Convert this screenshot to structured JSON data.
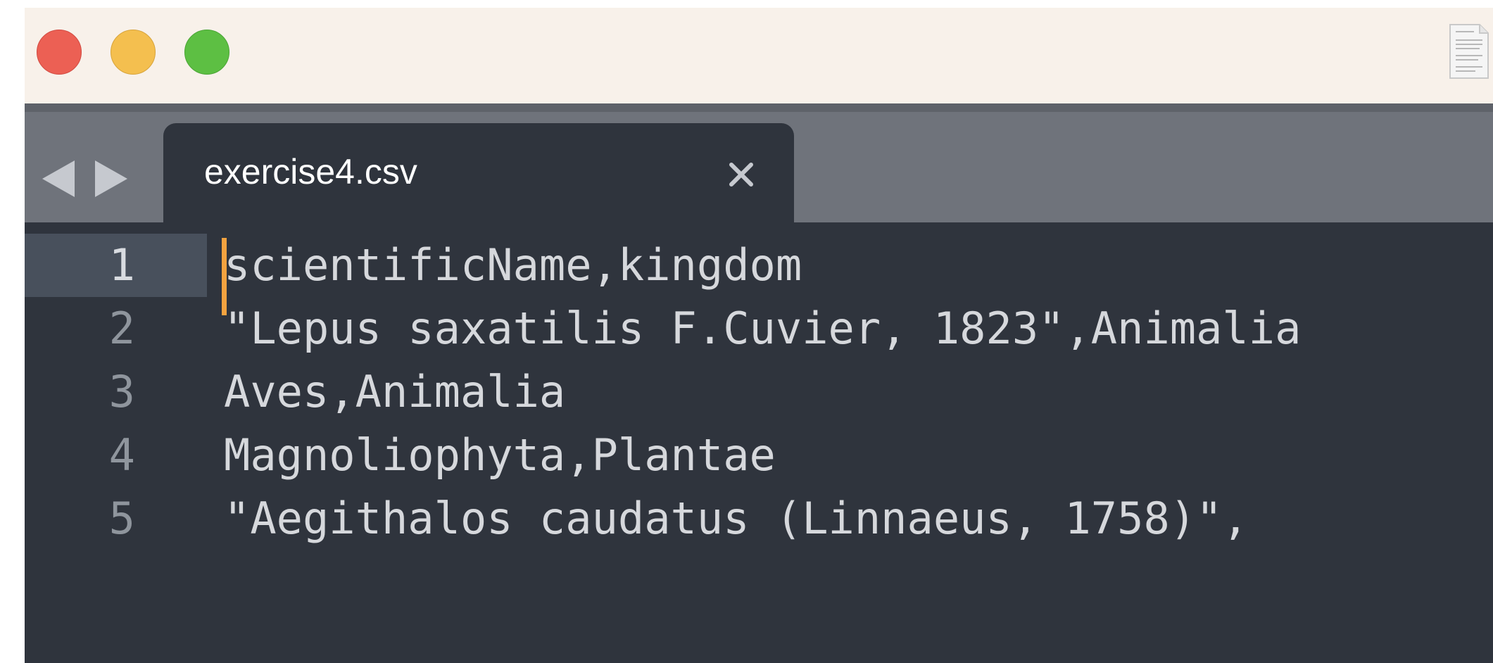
{
  "window": {
    "traffic_lights": [
      {
        "name": "close",
        "color": "#ec6054"
      },
      {
        "name": "minimize",
        "color": "#f4bf4f"
      },
      {
        "name": "zoom",
        "color": "#5dbf43"
      }
    ],
    "proxy_icon": "document-icon"
  },
  "tabbar": {
    "back_icon": "chevron-left-icon",
    "forward_icon": "chevron-right-icon",
    "active_tab": {
      "title": "exercise4.csv",
      "close_icon": "close-icon"
    }
  },
  "editor": {
    "current_line": 1,
    "lines": [
      {
        "number": "1",
        "text": "scientificName,kingdom"
      },
      {
        "number": "2",
        "text": "\"Lepus saxatilis F.Cuvier, 1823\",Animalia"
      },
      {
        "number": "3",
        "text": "Aves,Animalia"
      },
      {
        "number": "4",
        "text": "Magnoliophyta,Plantae"
      },
      {
        "number": "5",
        "text": "\"Aegithalos caudatus (Linnaeus, 1758)\","
      }
    ]
  },
  "colors": {
    "titlebar": "#f8f1ea",
    "tabbar": "#6f737b",
    "editor_background": "#2f343d",
    "cursor": "#f4a340",
    "text": "#d6d8dc",
    "line_number": "#8f959d"
  }
}
